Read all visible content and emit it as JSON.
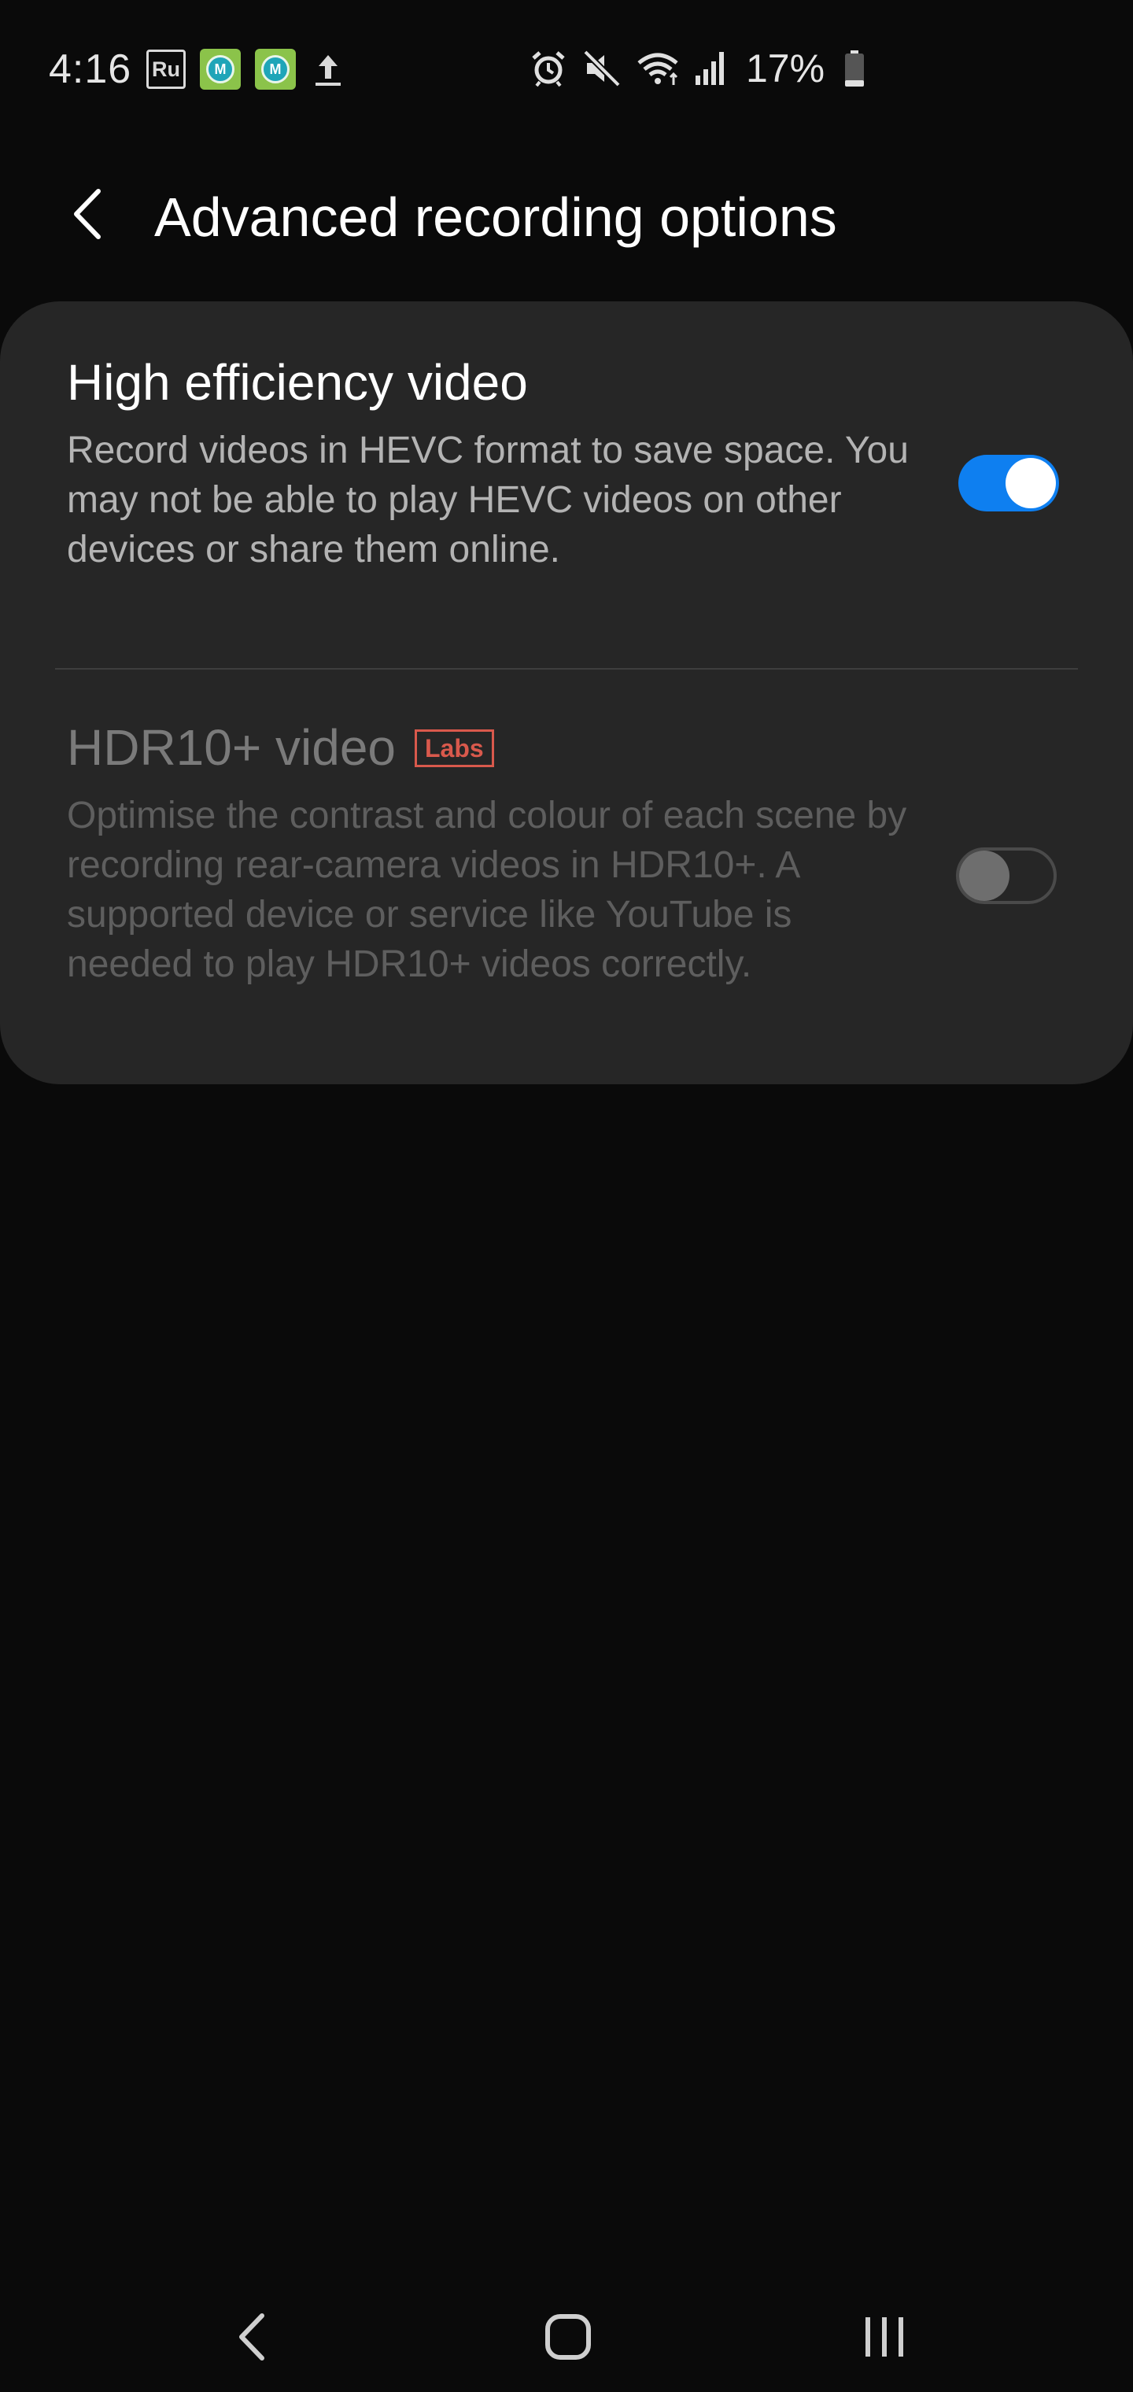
{
  "status_bar": {
    "time": "4:16",
    "notifications": [
      {
        "icon": "ru-icon",
        "label": "Ru"
      },
      {
        "icon": "app-icon",
        "label": "M"
      },
      {
        "icon": "app-icon",
        "label": "M"
      },
      {
        "icon": "upload-icon"
      }
    ],
    "system_icons": [
      "alarm-icon",
      "mute-icon",
      "wifi-icon",
      "signal-icon"
    ],
    "battery_percent": "17%"
  },
  "header": {
    "title": "Advanced recording options"
  },
  "settings": [
    {
      "title": "High efficiency video",
      "description": "Record videos in HEVC format to save space. You may not be able to play HEVC videos on other devices or share them online.",
      "enabled": true,
      "toggle_on": true
    },
    {
      "title": "HDR10+ video",
      "badge": "Labs",
      "description": "Optimise the contrast and colour of each scene by recording rear-camera videos in HDR10+. A supported device or service like YouTube is needed to play HDR10+ videos correctly.",
      "enabled": false,
      "toggle_on": false
    }
  ],
  "colors": {
    "background": "#0a0a0a",
    "card": "#262626",
    "accent": "#0e7ff0",
    "labs_badge": "#d9594c"
  },
  "nav_bar": {
    "buttons": [
      "back-icon",
      "home-icon",
      "recents-icon"
    ]
  }
}
